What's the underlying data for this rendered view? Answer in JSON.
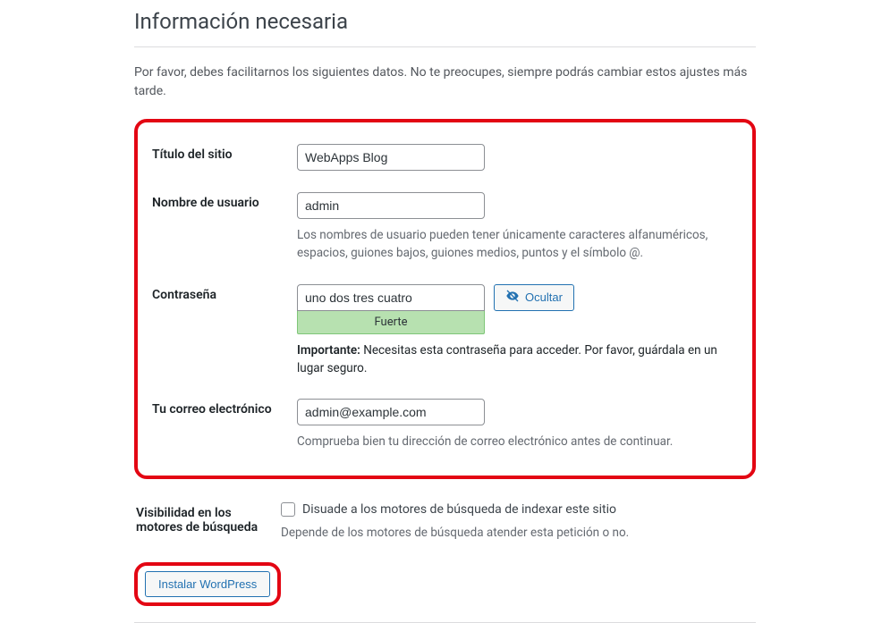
{
  "heading": "Información necesaria",
  "intro": "Por favor, debes facilitarnos los siguientes datos. No te preocupes, siempre podrás cambiar estos ajustes más tarde.",
  "fields": {
    "site_title": {
      "label": "Título del sitio",
      "value": "WebApps Blog"
    },
    "username": {
      "label": "Nombre de usuario",
      "value": "admin",
      "hint": "Los nombres de usuario pueden tener únicamente caracteres alfanuméricos, espacios, guiones bajos, guiones medios, puntos y el símbolo @."
    },
    "password": {
      "label": "Contraseña",
      "value": "uno dos tres cuatro",
      "strength": "Fuerte",
      "hide_button": "Ocultar",
      "important_label": "Importante:",
      "important_text": " Necesitas esta contraseña para acceder. Por favor, guárdala en un lugar seguro."
    },
    "email": {
      "label": "Tu correo electrónico",
      "value": "admin@example.com",
      "hint": "Comprueba bien tu dirección de correo electrónico antes de continuar."
    },
    "visibility": {
      "label": "Visibilidad en los motores de búsqueda",
      "checkbox_label": "Disuade a los motores de búsqueda de indexar este sitio",
      "hint": "Depende de los motores de búsqueda atender esta petición o no."
    }
  },
  "submit": "Instalar WordPress"
}
